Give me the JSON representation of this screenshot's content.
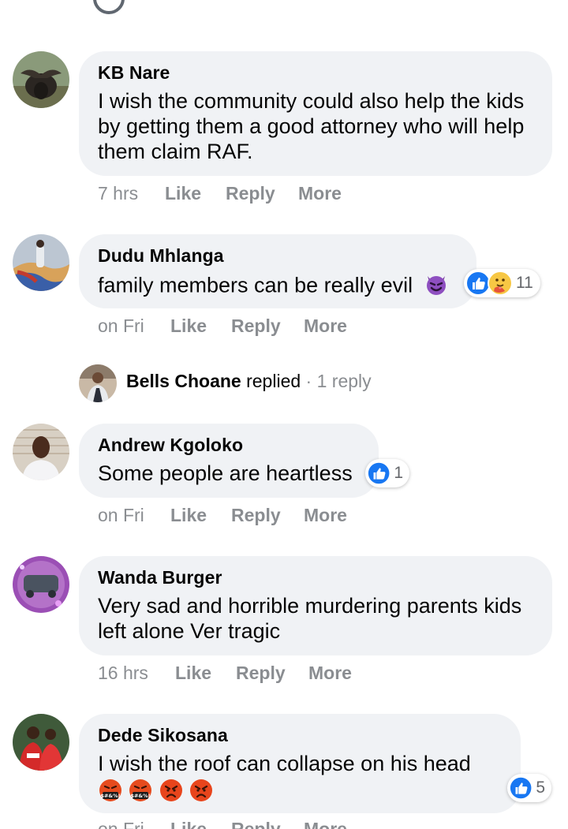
{
  "colors": {
    "bubble": "#f0f2f5",
    "muted": "#8a8d91",
    "like_blue": "#1877f2"
  },
  "comments": [
    {
      "author": "KB Nare",
      "text": "I wish the community could also help the kids by getting them a good attorney who will help them claim RAF.",
      "time": "7 hrs",
      "like": "Like",
      "reply": "Reply",
      "more": "More"
    },
    {
      "author": "Dudu Mhlanga",
      "text": "family members can be really evil",
      "emoji": "smiling-devil-emoji",
      "reactions": [
        "like-reaction-icon",
        "care-reaction-icon"
      ],
      "reaction_count": "11",
      "time": "on Fri",
      "like": "Like",
      "reply": "Reply",
      "more": "More"
    },
    {
      "author": "Andrew Kgoloko",
      "text": "Some people are heartless",
      "reactions": [
        "like-reaction-icon"
      ],
      "reaction_count": "1",
      "time": "on Fri",
      "like": "Like",
      "reply": "Reply",
      "more": "More"
    },
    {
      "author": "Wanda Burger",
      "text": "Very sad and horrible murdering parents kids left alone Ver tragic",
      "time": "16 hrs",
      "like": "Like",
      "reply": "Reply",
      "more": "More"
    },
    {
      "author": "Dede Sikosana",
      "text": "I wish the roof can collapse on his head",
      "emojis": [
        "cursing-face-emoji",
        "cursing-face-emoji",
        "angry-face-emoji",
        "angry-face-emoji"
      ],
      "reactions": [
        "like-reaction-icon"
      ],
      "reaction_count": "5",
      "time": "on Fri",
      "like": "Like",
      "reply": "Reply",
      "more": "More"
    }
  ],
  "reply_thread": {
    "name": "Bells Choane",
    "action": " replied",
    "separator": " · ",
    "count": "1 reply"
  }
}
